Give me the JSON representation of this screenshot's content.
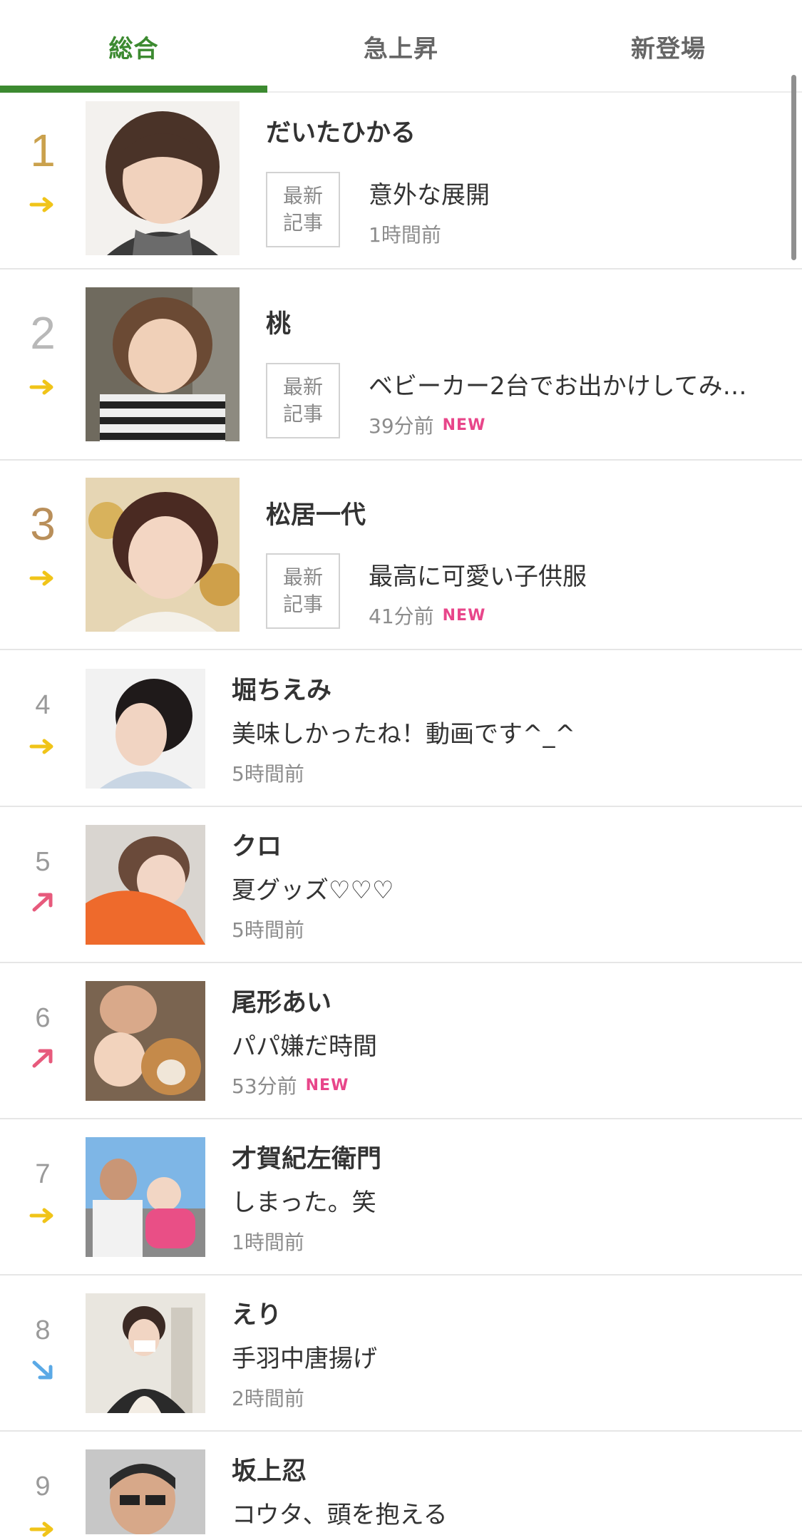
{
  "tabs": [
    {
      "label": "総合",
      "active": true
    },
    {
      "label": "急上昇",
      "active": false
    },
    {
      "label": "新登場",
      "active": false
    }
  ],
  "badge": {
    "line1": "最新",
    "line2": "記事"
  },
  "new_label": "NEW",
  "colors": {
    "accent": "#3c8a30",
    "trend_flat": "#f0c419",
    "trend_up": "#e75a7c",
    "trend_down": "#5aa9e6",
    "new_badge": "#e8468a"
  },
  "ranking": [
    {
      "rank": "1",
      "name": "だいたひかる",
      "title": "意外な展開",
      "time": "1時間前",
      "is_new": false,
      "trend": "flat"
    },
    {
      "rank": "2",
      "name": "桃",
      "title": "ベビーカー2台でお出かけしてみ…",
      "time": "39分前",
      "is_new": true,
      "trend": "flat"
    },
    {
      "rank": "3",
      "name": "松居一代",
      "title": "最高に可愛い子供服",
      "time": "41分前",
      "is_new": true,
      "trend": "flat"
    },
    {
      "rank": "4",
      "name": "堀ちえみ",
      "title": "美味しかったね！動画です^_^",
      "time": "5時間前",
      "is_new": false,
      "trend": "flat"
    },
    {
      "rank": "5",
      "name": "クロ",
      "title": "夏グッズ♡♡♡",
      "time": "5時間前",
      "is_new": false,
      "trend": "up"
    },
    {
      "rank": "6",
      "name": "尾形あい",
      "title": "パパ嫌だ時間",
      "time": "53分前",
      "is_new": true,
      "trend": "up"
    },
    {
      "rank": "7",
      "name": "才賀紀左衛門",
      "title": "しまった。笑",
      "time": "1時間前",
      "is_new": false,
      "trend": "flat"
    },
    {
      "rank": "8",
      "name": "えり",
      "title": "手羽中唐揚げ",
      "time": "2時間前",
      "is_new": false,
      "trend": "down"
    },
    {
      "rank": "9",
      "name": "坂上忍",
      "title": "コウタ、頭を抱える",
      "time": "",
      "is_new": false,
      "trend": "flat"
    }
  ]
}
